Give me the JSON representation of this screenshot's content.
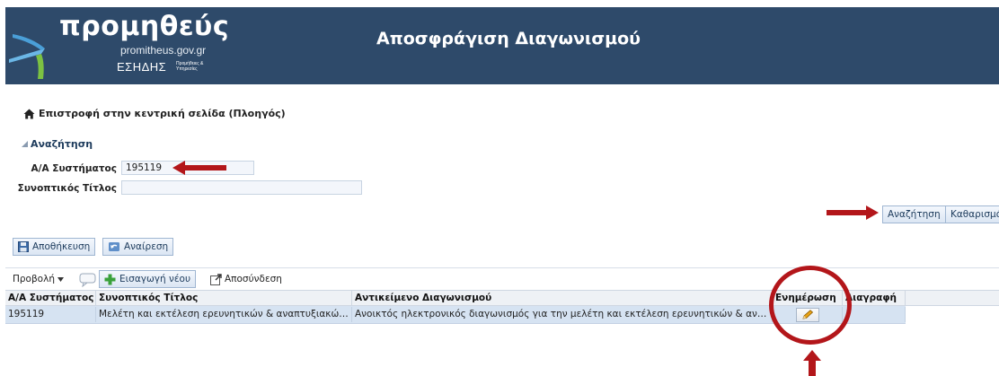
{
  "header": {
    "logo_brand": "προμηθεύς",
    "logo_site": "promitheus.gov.gr",
    "logo_system": "ΕΣΗΔΗΣ",
    "logo_system_sub": "Προμήθειες & Υπηρεσίες",
    "page_title": "Αποσφράγιση Διαγωνισμού",
    "brand_color": "#2e4a6a"
  },
  "nav": {
    "back_link": "Επιστροφή στην κεντρική σελίδα (Πλοηγός)"
  },
  "search": {
    "section_title": "Αναζήτηση",
    "system_id_label": "Α/Α Συστήματος",
    "system_id_value": "195119",
    "short_title_label": "Συνοπτικός Τίτλος",
    "short_title_value": "",
    "search_button": "Αναζήτηση",
    "clear_button": "Καθαρισμός"
  },
  "actions": {
    "save_button": "Αποθήκευση",
    "undo_button": "Αναίρεση"
  },
  "toolbar": {
    "view_menu": "Προβολή",
    "insert_new": "Εισαγωγή νέου",
    "detach": "Αποσύνδεση"
  },
  "table": {
    "columns": [
      "Α/Α Συστήματος",
      "Συνοπτικός Τίτλος",
      "Αντικείμενο Διαγωνισμού",
      "Ενημέρωση",
      "Διαγραφή"
    ],
    "rows": [
      {
        "system_id": "195119",
        "short_title": "Μελέτη και εκτέλεση ερευνητικών & αναπτυξιακών δρ...",
        "subject": "Ανοικτός ηλεκτρονικός διαγωνισμός για την μελέτη και εκτέλεση ερευνητικών & αναπτυξιακ..."
      }
    ]
  },
  "annotation_color": "#b3161a",
  "icons": [
    "home-icon",
    "collapse-triangle-icon",
    "save-icon",
    "undo-icon",
    "dropdown-arrow-icon",
    "comment-icon",
    "add-icon",
    "detach-icon",
    "pencil-icon"
  ]
}
